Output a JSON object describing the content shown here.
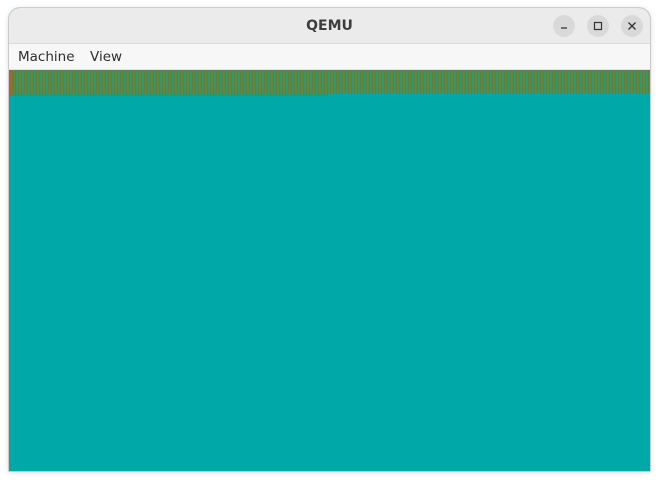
{
  "window": {
    "title": "QEMU",
    "controls": {
      "minimize_icon": "minimize-icon",
      "maximize_icon": "maximize-icon",
      "close_icon": "close-icon"
    }
  },
  "menubar": {
    "items": [
      {
        "label": "Machine"
      },
      {
        "label": "View"
      }
    ]
  },
  "display": {
    "background_color": "#00a8a8",
    "stripe_colors": [
      "#6e7a34",
      "#2a9a7a",
      "#a06a28"
    ]
  }
}
